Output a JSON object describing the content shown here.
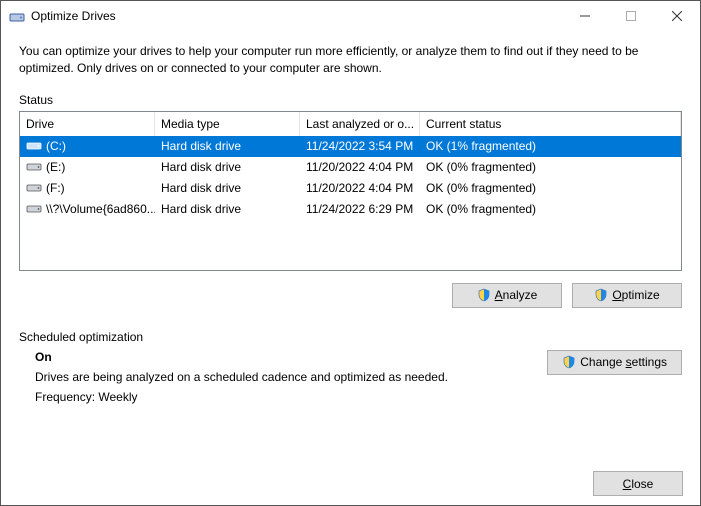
{
  "window": {
    "title": "Optimize Drives"
  },
  "intro": "You can optimize your drives to help your computer run more efficiently, or analyze them to find out if they need to be optimized. Only drives on or connected to your computer are shown.",
  "status_label": "Status",
  "columns": {
    "drive": "Drive",
    "media": "Media type",
    "last": "Last analyzed or o...",
    "status": "Current status"
  },
  "drives": [
    {
      "name": "(C:)",
      "media": "Hard disk drive",
      "last": "11/24/2022 3:54 PM",
      "status": "OK (1% fragmented)",
      "selected": true,
      "iconColor": "#fff"
    },
    {
      "name": "(E:)",
      "media": "Hard disk drive",
      "last": "11/20/2022 4:04 PM",
      "status": "OK (0% fragmented)",
      "selected": false,
      "iconColor": "#444"
    },
    {
      "name": "(F:)",
      "media": "Hard disk drive",
      "last": "11/20/2022 4:04 PM",
      "status": "OK (0% fragmented)",
      "selected": false,
      "iconColor": "#444"
    },
    {
      "name": "\\\\?\\Volume{6ad860...",
      "media": "Hard disk drive",
      "last": "11/24/2022 6:29 PM",
      "status": "OK (0% fragmented)",
      "selected": false,
      "iconColor": "#444"
    }
  ],
  "buttons": {
    "analyze": "Analyze",
    "optimize": "Optimize",
    "change": "Change settings",
    "close": "Close"
  },
  "schedule": {
    "label": "Scheduled optimization",
    "on": "On",
    "desc": "Drives are being analyzed on a scheduled cadence and optimized as needed.",
    "freq": "Frequency: Weekly"
  }
}
